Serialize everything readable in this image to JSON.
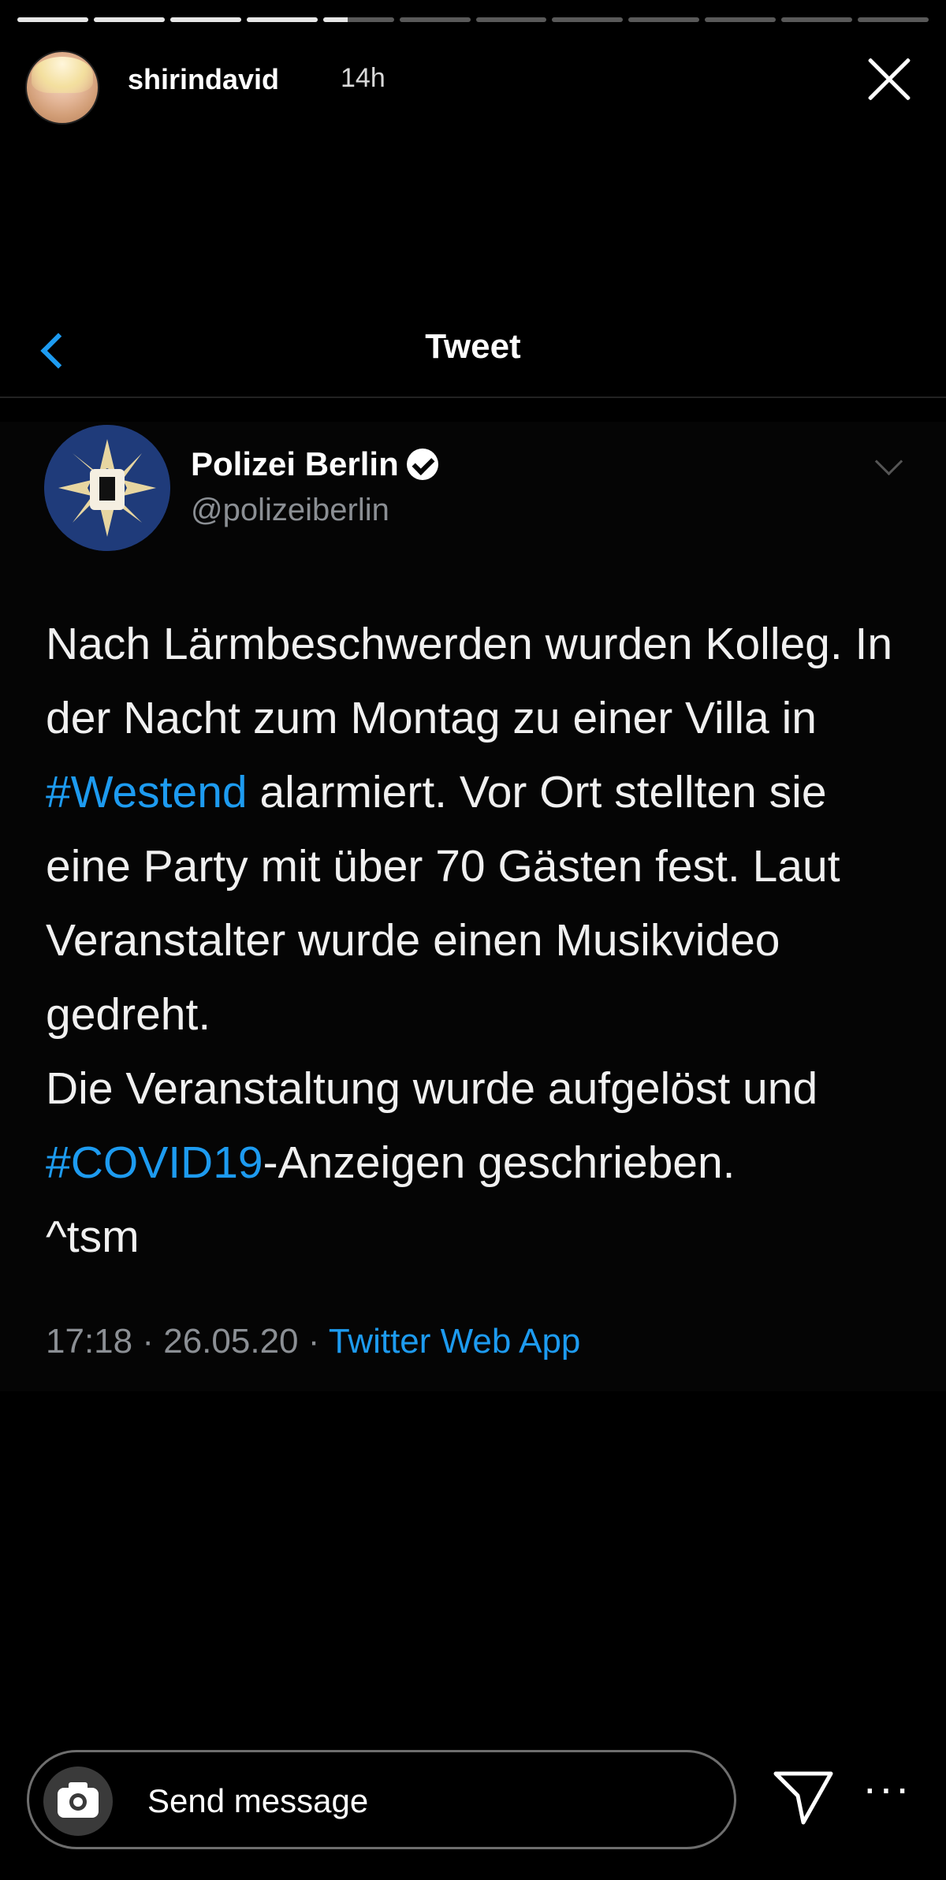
{
  "story": {
    "progress": [
      1,
      1,
      1,
      1,
      0.35,
      0,
      0,
      0,
      0,
      0,
      0,
      0
    ],
    "username": "shirindavid",
    "time": "14h"
  },
  "twitter": {
    "title": "Tweet",
    "author_name": "Polizei Berlin",
    "author_handle": "@polizeiberlin",
    "text": [
      {
        "t": "Nach Lärmbeschwerden wurden Kolleg. In der Nacht zum Montag zu einer Villa in "
      },
      {
        "t": "#Westend",
        "tag": true
      },
      {
        "t": " alarmiert. Vor Ort stellten sie eine Party mit über 70 Gästen fest. Laut Veranstalter wurde einen Musikvideo gedreht."
      },
      {
        "br": true
      },
      {
        "t": "Die Veranstaltung wurde aufgelöst und "
      },
      {
        "t": "#COVID19",
        "tag": true
      },
      {
        "t": "-Anzeigen geschrieben."
      },
      {
        "br": true
      },
      {
        "t": "^tsm"
      }
    ],
    "time": "17:18",
    "date": "26.05.20",
    "separator": "·",
    "source": "Twitter Web App"
  },
  "composer": {
    "placeholder": "Send message"
  },
  "colors": {
    "link": "#1d9bf0",
    "muted": "#8b8f94"
  },
  "icons": [
    "close-icon",
    "back-chevron-icon",
    "verified-badge-icon",
    "caret-down-icon",
    "camera-icon",
    "send-icon",
    "more-icon"
  ]
}
